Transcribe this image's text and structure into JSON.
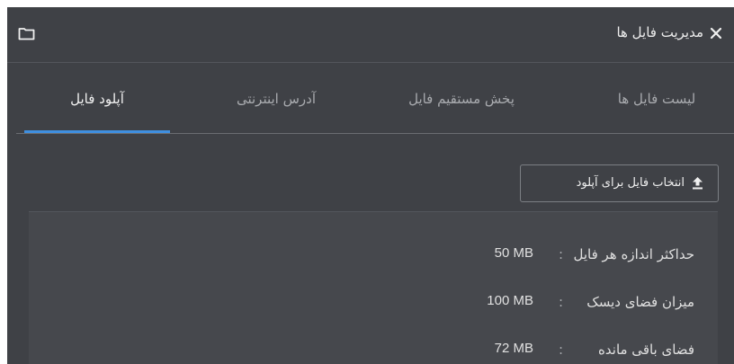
{
  "window": {
    "title": "مدیریت فایل ها"
  },
  "tabs": [
    {
      "label": "لیست فایل ها",
      "active": false
    },
    {
      "label": "پخش مستقیم فایل",
      "active": false
    },
    {
      "label": "آدرس اینترنتی",
      "active": false
    },
    {
      "label": "آپلود فایل",
      "active": true
    }
  ],
  "upload": {
    "button_label": "انتخاب فایل برای آپلود"
  },
  "info": {
    "rows": [
      {
        "label": "حداکثر اندازه هر فایل",
        "colon": ":",
        "value": "50 MB"
      },
      {
        "label": "میزان فضای دیسک",
        "colon": ":",
        "value": "100 MB"
      },
      {
        "label": "فضای باقی مانده",
        "colon": ":",
        "value": "72 MB"
      }
    ]
  },
  "colors": {
    "background": "#3f4146",
    "accent": "#3f8fe0",
    "panel": "#46484d"
  },
  "icons": [
    "close-icon",
    "folder-icon",
    "upload-icon"
  ]
}
